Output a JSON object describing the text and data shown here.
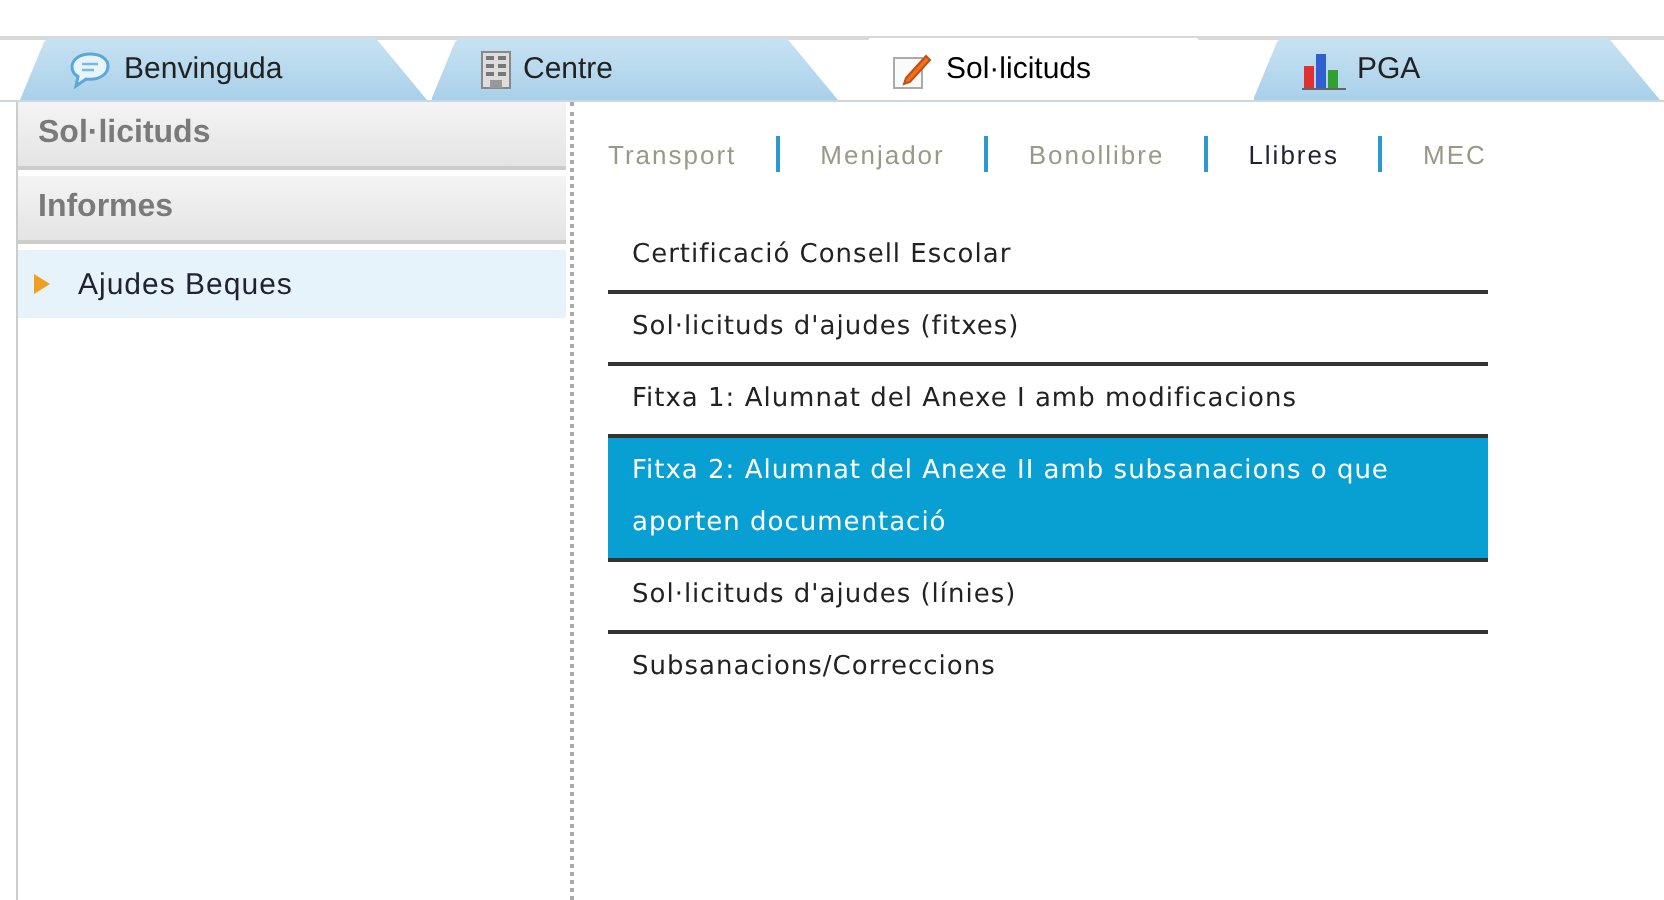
{
  "tabs": [
    {
      "label": "Benvinguda",
      "kind": "chat",
      "selected": false
    },
    {
      "label": "Centre",
      "kind": "building",
      "selected": false
    },
    {
      "label": "Sol·licituds",
      "kind": "pencil",
      "selected": true
    },
    {
      "label": "PGA",
      "kind": "chart",
      "selected": false
    }
  ],
  "sidebar": {
    "sections": [
      {
        "title": "Sol·licituds"
      },
      {
        "title": "Informes"
      }
    ],
    "items": [
      {
        "label": "Ajudes Beques",
        "selected": true
      }
    ]
  },
  "subnav": [
    {
      "label": "Transport",
      "selected": false
    },
    {
      "label": "Menjador",
      "selected": false
    },
    {
      "label": "Bonollibre",
      "selected": false
    },
    {
      "label": "Llibres",
      "selected": true
    },
    {
      "label": "MEC",
      "selected": false
    }
  ],
  "list": [
    {
      "label": "Certificació Consell Escolar",
      "selected": false
    },
    {
      "label": "Sol·licituds d'ajudes (fitxes)",
      "selected": false
    },
    {
      "label": "Fitxa 1: Alumnat del Anexe I amb modificacions",
      "selected": false
    },
    {
      "label": "Fitxa 2: Alumnat del Anexe II amb subsanacions o que aporten documentació",
      "selected": true
    },
    {
      "label": "Sol·licituds d'ajudes (línies)",
      "selected": false
    },
    {
      "label": "Subsanacions/Correccions",
      "selected": false
    }
  ]
}
